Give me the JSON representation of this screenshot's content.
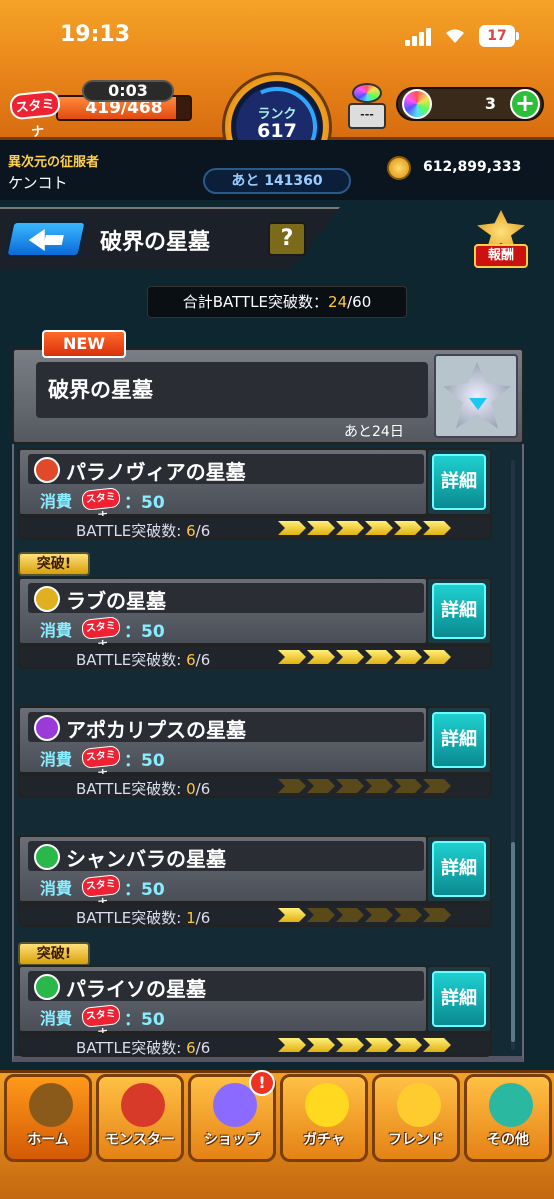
{
  "status_bar": {
    "time": "19:13",
    "battery": "17"
  },
  "hud": {
    "stamina_label": "スタミナ",
    "stamina_timer": "0:03",
    "stamina_count": "419/468",
    "stamina_fraction": 0.895,
    "rank_label": "ランク",
    "rank_value": "617",
    "next_rank": "あと 141360",
    "stone_box_label": "---",
    "orb_count": "3",
    "orb_plus": "+",
    "player_title": "異次元の征服者",
    "player_name": "ケンコト",
    "coins": "612,899,333"
  },
  "quest_header": {
    "back_icon": "back-arrow-icon",
    "title": "破界の星墓",
    "help": "?",
    "reward_label": "報酬"
  },
  "total": {
    "prefix": "合計BATTLE突破数：",
    "value": "24",
    "suffix": "/60"
  },
  "stage": {
    "new_badge": "NEW",
    "name": "破界の星墓",
    "remaining": "あと24日"
  },
  "quests": [
    {
      "name": "パラノヴィアの星墓",
      "icon_color": "#e04a2a",
      "cost_label": "消費",
      "stamina": "スタミナ",
      "cost": "：50",
      "detail": "詳細",
      "progress_label": "BATTLE突破数:",
      "progress_value": "6",
      "progress_total": "/6",
      "cleared": 6,
      "breakthrough": ""
    },
    {
      "name": "ラブの星墓",
      "icon_color": "#e0b020",
      "cost_label": "消費",
      "stamina": "スタミナ",
      "cost": "：50",
      "detail": "詳細",
      "progress_label": "BATTLE突破数:",
      "progress_value": "6",
      "progress_total": "/6",
      "cleared": 6,
      "breakthrough": "突破!"
    },
    {
      "name": "アポカリプスの星墓",
      "icon_color": "#9a3ad8",
      "cost_label": "消費",
      "stamina": "スタミナ",
      "cost": "：50",
      "detail": "詳細",
      "progress_label": "BATTLE突破数:",
      "progress_value": "0",
      "progress_total": "/6",
      "cleared": 0,
      "breakthrough": ""
    },
    {
      "name": "シャンバラの星墓",
      "icon_color": "#2ab84a",
      "cost_label": "消費",
      "stamina": "スタミナ",
      "cost": "：50",
      "detail": "詳細",
      "progress_label": "BATTLE突破数:",
      "progress_value": "1",
      "progress_total": "/6",
      "cleared": 1,
      "breakthrough": ""
    },
    {
      "name": "パライソの星墓",
      "icon_color": "#2ab84a",
      "cost_label": "消費",
      "stamina": "スタミナ",
      "cost": "：50",
      "detail": "詳細",
      "progress_label": "BATTLE突破数:",
      "progress_value": "6",
      "progress_total": "/6",
      "cleared": 6,
      "breakthrough": "突破!"
    }
  ],
  "nav": [
    {
      "label": "ホーム",
      "icon": "home-icon",
      "color": "#8a5a1a"
    },
    {
      "label": "モンスター",
      "icon": "monster-icon",
      "color": "#d83a2a"
    },
    {
      "label": "ショップ",
      "icon": "orb-icon",
      "color": "#8a6aff",
      "badge": "!"
    },
    {
      "label": "ガチャ",
      "icon": "gacha-icon",
      "color": "#ffd820"
    },
    {
      "label": "フレンド",
      "icon": "friend-icon",
      "color": "#ffcc30"
    },
    {
      "label": "その他",
      "icon": "other-icon",
      "color": "#2ab8a0"
    }
  ]
}
